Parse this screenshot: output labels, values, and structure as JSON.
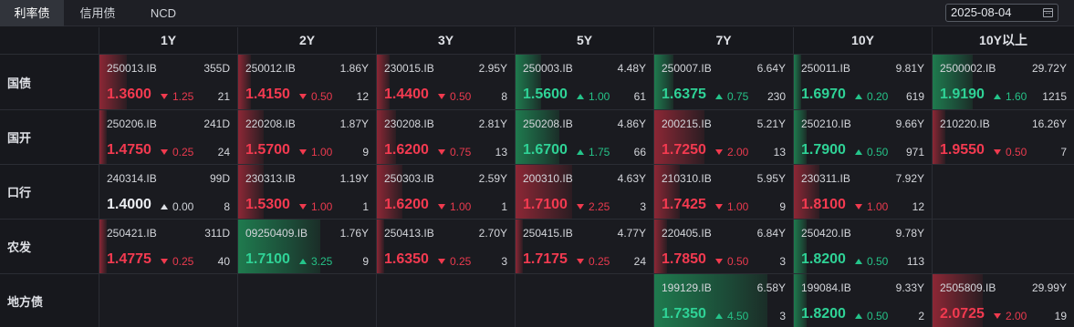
{
  "tabs": [
    {
      "label": "利率债",
      "active": true
    },
    {
      "label": "信用债",
      "active": false
    },
    {
      "label": "NCD",
      "active": false
    }
  ],
  "date": "2025-08-04",
  "columns": [
    "1Y",
    "2Y",
    "3Y",
    "5Y",
    "7Y",
    "10Y",
    "10Y以上"
  ],
  "rows": [
    {
      "label": "国债",
      "cells": [
        {
          "code": "250013.IB",
          "term": "355D",
          "yield": "1.3600",
          "dir": "down",
          "change": "1.25",
          "count": "21",
          "fill": 0.22
        },
        {
          "code": "250012.IB",
          "term": "1.86Y",
          "yield": "1.4150",
          "dir": "down",
          "change": "0.50",
          "count": "12",
          "fill": 0.1
        },
        {
          "code": "230015.IB",
          "term": "2.95Y",
          "yield": "1.4400",
          "dir": "down",
          "change": "0.50",
          "count": "8",
          "fill": 0.1
        },
        {
          "code": "250003.IB",
          "term": "4.48Y",
          "yield": "1.5600",
          "dir": "up",
          "change": "1.00",
          "count": "61",
          "fill": 0.2
        },
        {
          "code": "250007.IB",
          "term": "6.64Y",
          "yield": "1.6375",
          "dir": "up",
          "change": "0.75",
          "count": "230",
          "fill": 0.15
        },
        {
          "code": "250011.IB",
          "term": "9.81Y",
          "yield": "1.6970",
          "dir": "up",
          "change": "0.20",
          "count": "619",
          "fill": 0.04
        },
        {
          "code": "2500002.IB",
          "term": "29.72Y",
          "yield": "1.9190",
          "dir": "up",
          "change": "1.60",
          "count": "1215",
          "fill": 0.32
        }
      ]
    },
    {
      "label": "国开",
      "cells": [
        {
          "code": "250206.IB",
          "term": "241D",
          "yield": "1.4750",
          "dir": "down",
          "change": "0.25",
          "count": "24",
          "fill": 0.05
        },
        {
          "code": "220208.IB",
          "term": "1.87Y",
          "yield": "1.5700",
          "dir": "down",
          "change": "1.00",
          "count": "9",
          "fill": 0.2
        },
        {
          "code": "230208.IB",
          "term": "2.81Y",
          "yield": "1.6200",
          "dir": "down",
          "change": "0.75",
          "count": "13",
          "fill": 0.15
        },
        {
          "code": "250208.IB",
          "term": "4.86Y",
          "yield": "1.6700",
          "dir": "up",
          "change": "1.75",
          "count": "66",
          "fill": 0.35
        },
        {
          "code": "200215.IB",
          "term": "5.21Y",
          "yield": "1.7250",
          "dir": "down",
          "change": "2.00",
          "count": "13",
          "fill": 0.4
        },
        {
          "code": "250210.IB",
          "term": "9.66Y",
          "yield": "1.7900",
          "dir": "up",
          "change": "0.50",
          "count": "971",
          "fill": 0.1
        },
        {
          "code": "210220.IB",
          "term": "16.26Y",
          "yield": "1.9550",
          "dir": "down",
          "change": "0.50",
          "count": "7",
          "fill": 0.1
        }
      ]
    },
    {
      "label": "口行",
      "cells": [
        {
          "code": "240314.IB",
          "term": "99D",
          "yield": "1.4000",
          "dir": "flat",
          "change": "0.00",
          "count": "8",
          "fill": 0
        },
        {
          "code": "230313.IB",
          "term": "1.19Y",
          "yield": "1.5300",
          "dir": "down",
          "change": "1.00",
          "count": "1",
          "fill": 0.2
        },
        {
          "code": "250303.IB",
          "term": "2.59Y",
          "yield": "1.6200",
          "dir": "down",
          "change": "1.00",
          "count": "1",
          "fill": 0.2
        },
        {
          "code": "200310.IB",
          "term": "4.63Y",
          "yield": "1.7100",
          "dir": "down",
          "change": "2.25",
          "count": "3",
          "fill": 0.45
        },
        {
          "code": "210310.IB",
          "term": "5.95Y",
          "yield": "1.7425",
          "dir": "down",
          "change": "1.00",
          "count": "9",
          "fill": 0.2
        },
        {
          "code": "230311.IB",
          "term": "7.92Y",
          "yield": "1.8100",
          "dir": "down",
          "change": "1.00",
          "count": "12",
          "fill": 0.2
        },
        null
      ]
    },
    {
      "label": "农发",
      "cells": [
        {
          "code": "250421.IB",
          "term": "311D",
          "yield": "1.4775",
          "dir": "down",
          "change": "0.25",
          "count": "40",
          "fill": 0.05
        },
        {
          "code": "09250409.IB",
          "term": "1.76Y",
          "yield": "1.7100",
          "dir": "up",
          "change": "3.25",
          "count": "9",
          "fill": 0.65
        },
        {
          "code": "250413.IB",
          "term": "2.70Y",
          "yield": "1.6350",
          "dir": "down",
          "change": "0.25",
          "count": "3",
          "fill": 0.05
        },
        {
          "code": "250415.IB",
          "term": "4.77Y",
          "yield": "1.7175",
          "dir": "down",
          "change": "0.25",
          "count": "24",
          "fill": 0.05
        },
        {
          "code": "220405.IB",
          "term": "6.84Y",
          "yield": "1.7850",
          "dir": "down",
          "change": "0.50",
          "count": "3",
          "fill": 0.1
        },
        {
          "code": "250420.IB",
          "term": "9.78Y",
          "yield": "1.8200",
          "dir": "up",
          "change": "0.50",
          "count": "113",
          "fill": 0.1
        },
        null
      ]
    },
    {
      "label": "地方债",
      "cells": [
        null,
        null,
        null,
        null,
        {
          "code": "199129.IB",
          "term": "6.58Y",
          "yield": "1.7350",
          "dir": "up",
          "change": "4.50",
          "count": "3",
          "fill": 0.9
        },
        {
          "code": "199084.IB",
          "term": "9.33Y",
          "yield": "1.8200",
          "dir": "up",
          "change": "0.50",
          "count": "2",
          "fill": 0.1
        },
        {
          "code": "2505809.IB",
          "term": "29.99Y",
          "yield": "2.0725",
          "dir": "down",
          "change": "2.00",
          "count": "19",
          "fill": 0.4
        }
      ]
    }
  ],
  "colors": {
    "up": "#2fd296",
    "down": "#f33a50",
    "background": "#17181d"
  }
}
